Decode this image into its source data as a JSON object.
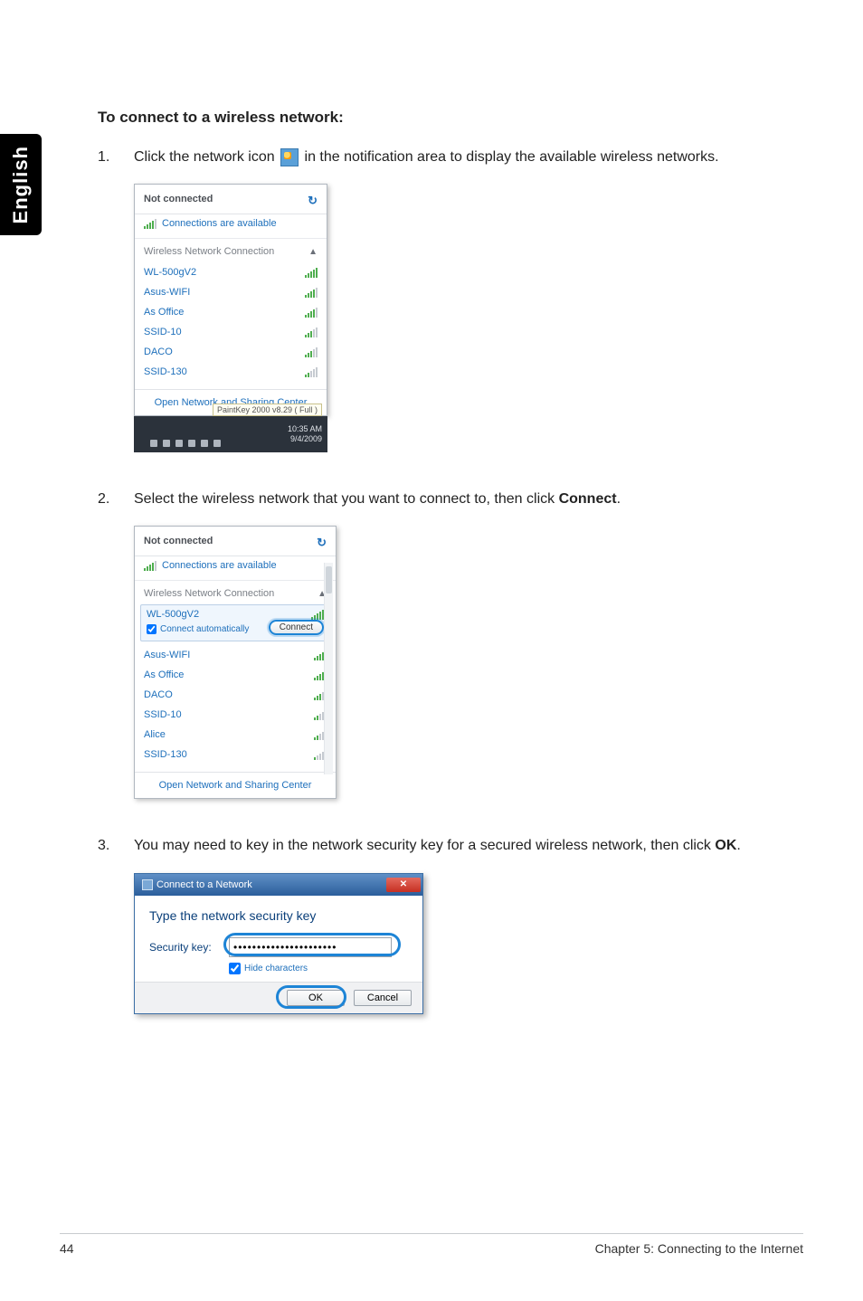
{
  "sidebar_language": "English",
  "heading": "To connect to a wireless network:",
  "step1": {
    "num": "1.",
    "text_before": "Click the network icon ",
    "text_after": " in the notification area to display the available wireless networks."
  },
  "step2": {
    "num": "2.",
    "text_a": "Select the wireless network that you want to connect to, then click ",
    "bold": "Connect",
    "text_b": "."
  },
  "step3": {
    "num": "3.",
    "text_a": "You may need to key in the network security key for a secured wireless network, then click ",
    "bold": "OK",
    "text_b": "."
  },
  "flyout1": {
    "title": "Not connected",
    "refresh_sym": "↻",
    "available": "Connections are available",
    "section": "Wireless Network Connection",
    "section_chevron": "▲",
    "networks": [
      {
        "name": "WL-500gV2",
        "bars": 5
      },
      {
        "name": "Asus-WIFI",
        "bars": 4
      },
      {
        "name": "As Office",
        "bars": 4
      },
      {
        "name": "SSID-10",
        "bars": 3
      },
      {
        "name": "DACO",
        "bars": 3
      },
      {
        "name": "SSID-130",
        "bars": 2
      }
    ],
    "footer": "Open Network and Sharing Center",
    "tray_tooltip": "PaintKey 2000 v8.29 ( Full )",
    "tray_time": "10:35 AM",
    "tray_date": "9/4/2009"
  },
  "flyout2": {
    "title": "Not connected",
    "refresh_sym": "↻",
    "available": "Connections are available",
    "section": "Wireless Network Connection",
    "section_chevron": "▲",
    "selected": {
      "name": "WL-500gV2",
      "auto_label": "Connect automatically",
      "connect_button": "Connect"
    },
    "networks": [
      {
        "name": "Asus-WIFI",
        "bars": 5
      },
      {
        "name": "As Office",
        "bars": 4
      },
      {
        "name": "DACO",
        "bars": 3
      },
      {
        "name": "SSID-10",
        "bars": 2
      },
      {
        "name": "Alice",
        "bars": 2
      },
      {
        "name": "SSID-130",
        "bars": 1
      }
    ],
    "footer": "Open Network and Sharing Center"
  },
  "dialog": {
    "title": "Connect to a Network",
    "prompt": "Type the network security key",
    "key_label": "Security key:",
    "key_value": "••••••••••••••••••••••",
    "hide_label": "Hide characters",
    "ok": "OK",
    "cancel": "Cancel",
    "close_glyph": "✕"
  },
  "footer": {
    "page": "44",
    "chapter": "Chapter 5: Connecting to the Internet"
  }
}
